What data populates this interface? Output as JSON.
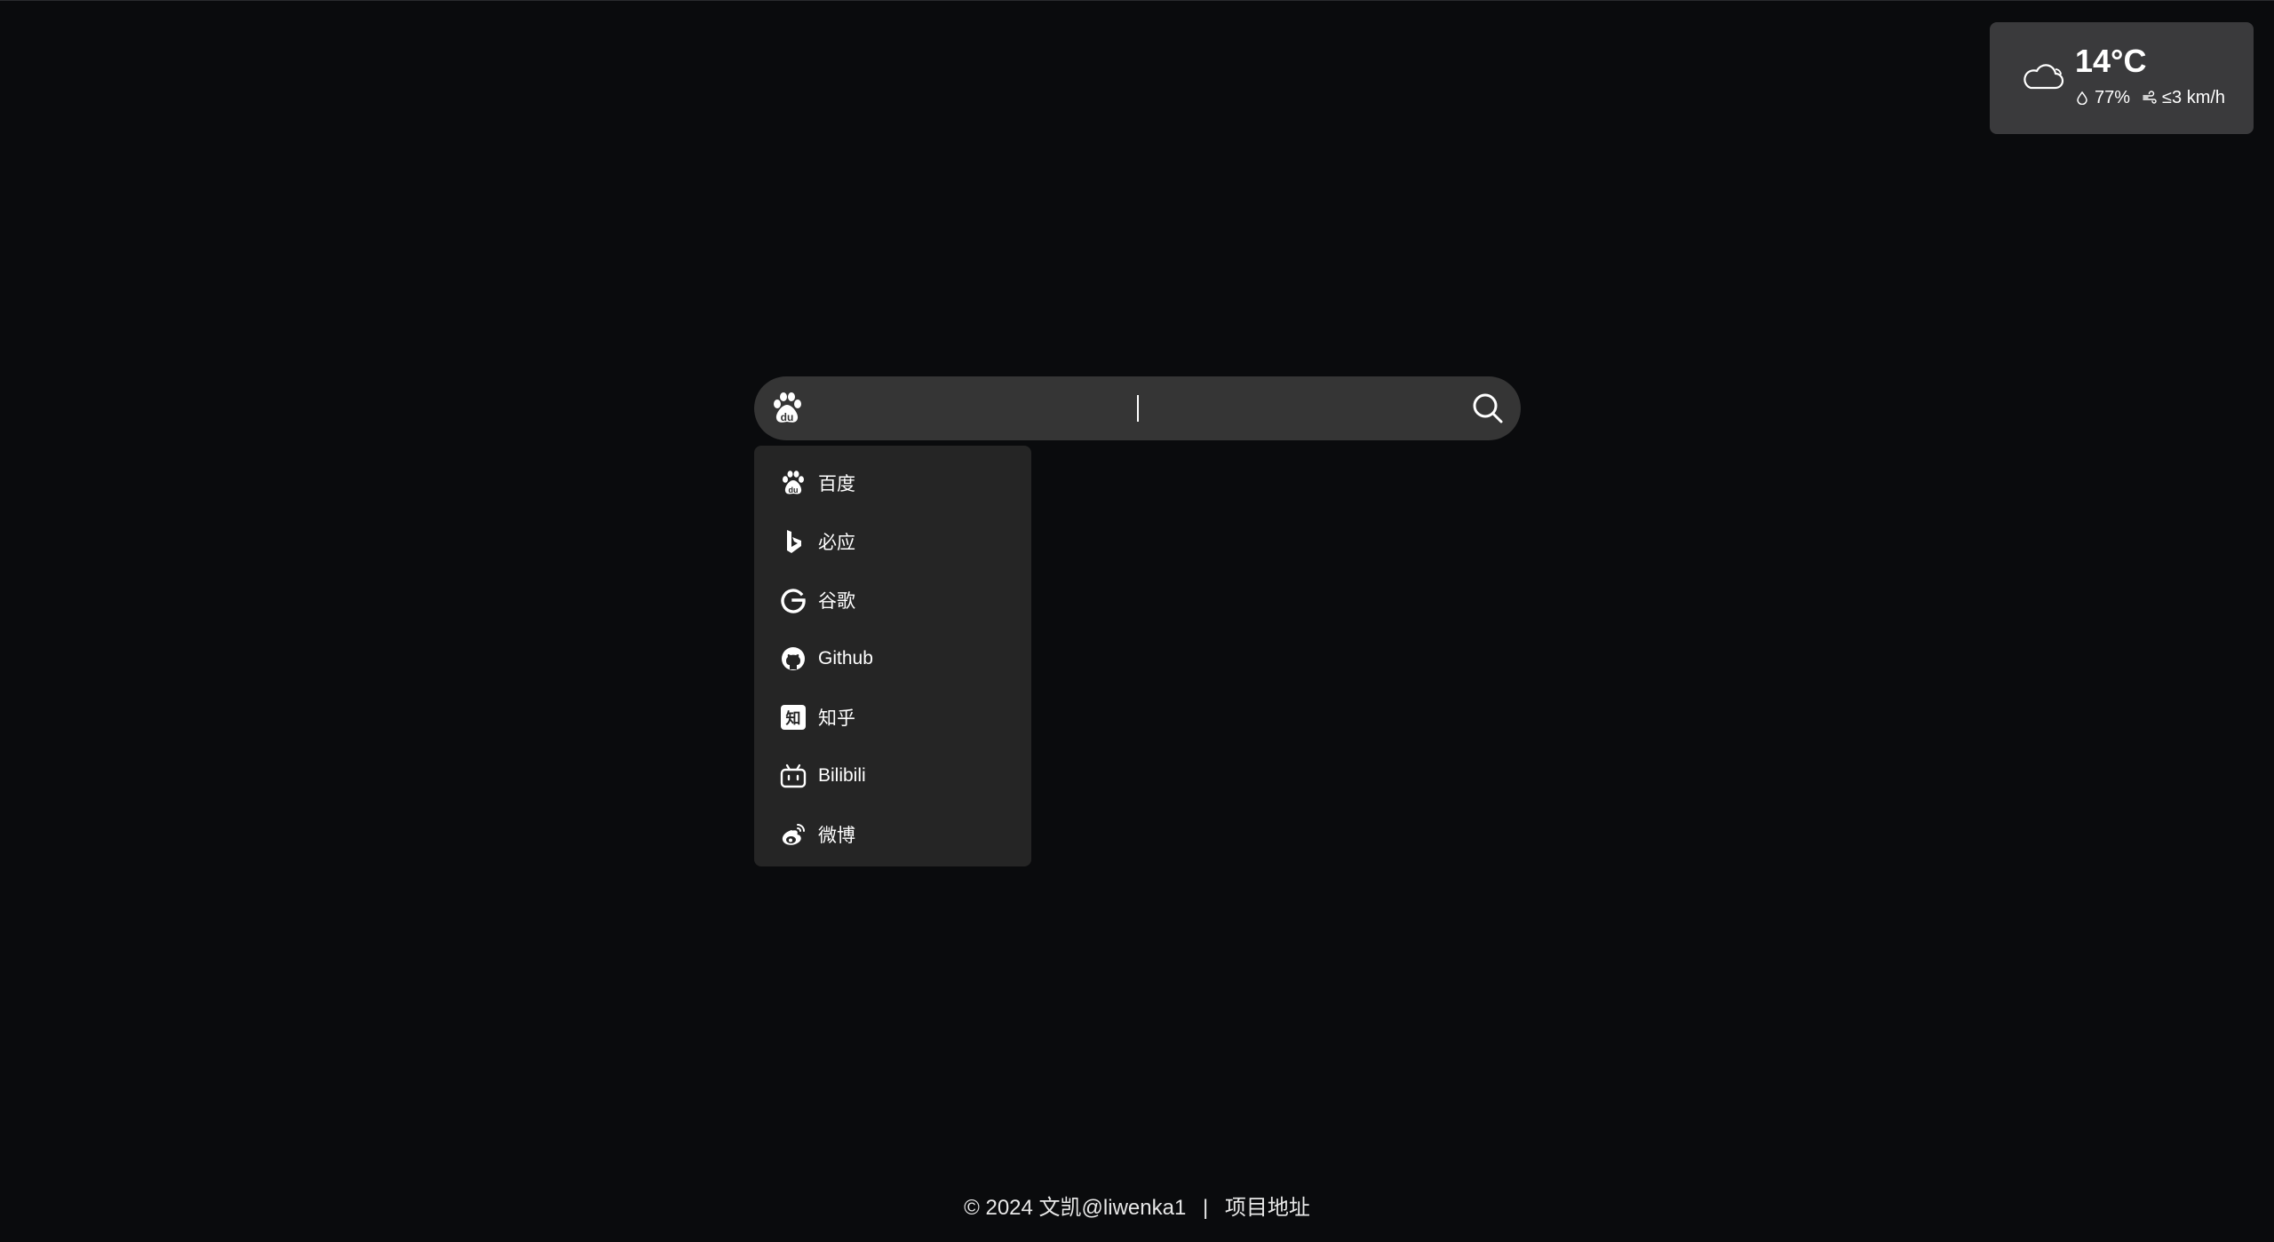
{
  "weather": {
    "temperature": "14°C",
    "humidity": "77%",
    "wind": "≤3 km/h",
    "icon": "cloud-icon"
  },
  "search": {
    "engine_icon": "baidu-icon",
    "value": "",
    "placeholder": ""
  },
  "engines": [
    {
      "label": "百度",
      "icon": "baidu-icon"
    },
    {
      "label": "必应",
      "icon": "bing-icon"
    },
    {
      "label": "谷歌",
      "icon": "google-icon"
    },
    {
      "label": "Github",
      "icon": "github-icon"
    },
    {
      "label": "知乎",
      "icon": "zhihu-icon"
    },
    {
      "label": "Bilibili",
      "icon": "bilibili-icon"
    },
    {
      "label": "微博",
      "icon": "weibo-icon"
    }
  ],
  "footer": {
    "copyright": "© 2024",
    "author": "文凯@liwenka1",
    "separator": "|",
    "project_link": "项目地址"
  }
}
